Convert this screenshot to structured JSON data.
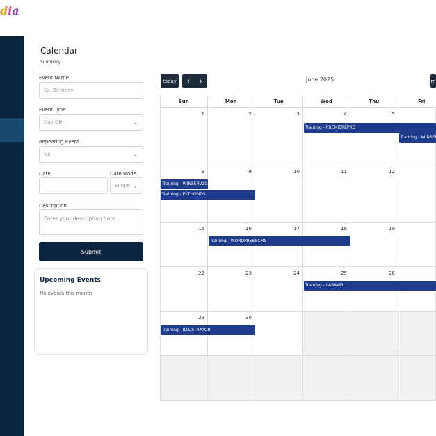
{
  "brand": {
    "logo_a": "d",
    "logo_b": "i",
    "logo_c": "a"
  },
  "header": {
    "title": "Calendar",
    "subtitle": "Summary"
  },
  "form": {
    "event_name_label": "Event Name",
    "event_name_placeholder": "Ex. Birthday",
    "event_type_label": "Event Type",
    "event_type_value": "Day Off",
    "repeating_label": "Repeating Event",
    "repeating_value": "No",
    "date_label": "Date",
    "date_mode_label": "Date Mode",
    "date_mode_value": "Single",
    "description_label": "Description",
    "description_placeholder": "Enter your description here...",
    "submit_label": "Submit"
  },
  "upcoming": {
    "title": "Upcoming Events",
    "empty_text": "No events this month"
  },
  "toolbar": {
    "today_label": "today",
    "prev_icon": "‹",
    "next_icon": "›",
    "month_title": "June 2025",
    "right_button": "m"
  },
  "calendar": {
    "day_names": [
      "Sun",
      "Mon",
      "Tue",
      "Wed",
      "Thu",
      "Fri"
    ],
    "weeks": [
      [
        "",
        "1",
        "2",
        "3",
        "4",
        "5"
      ],
      [
        "",
        "8",
        "9",
        "10",
        "11",
        "12"
      ],
      [
        "",
        "15",
        "16",
        "17",
        "18",
        "19"
      ],
      [
        "",
        "22",
        "23",
        "24",
        "25",
        "26"
      ],
      [
        "",
        "29",
        "30",
        "",
        "",
        ""
      ]
    ],
    "events": [
      "Training - PREMIEREPRO",
      "Training - WINSER",
      "Training - WINSERV202",
      "Training - PYTHONDS",
      "Training - WORDPRESSCMS",
      "Training - LARAVEL",
      "Training - ILLUSTRATOR"
    ]
  },
  "colors": {
    "sidebar": "#0b2540",
    "event": "#1f3b8c",
    "submit": "#0b2540"
  }
}
